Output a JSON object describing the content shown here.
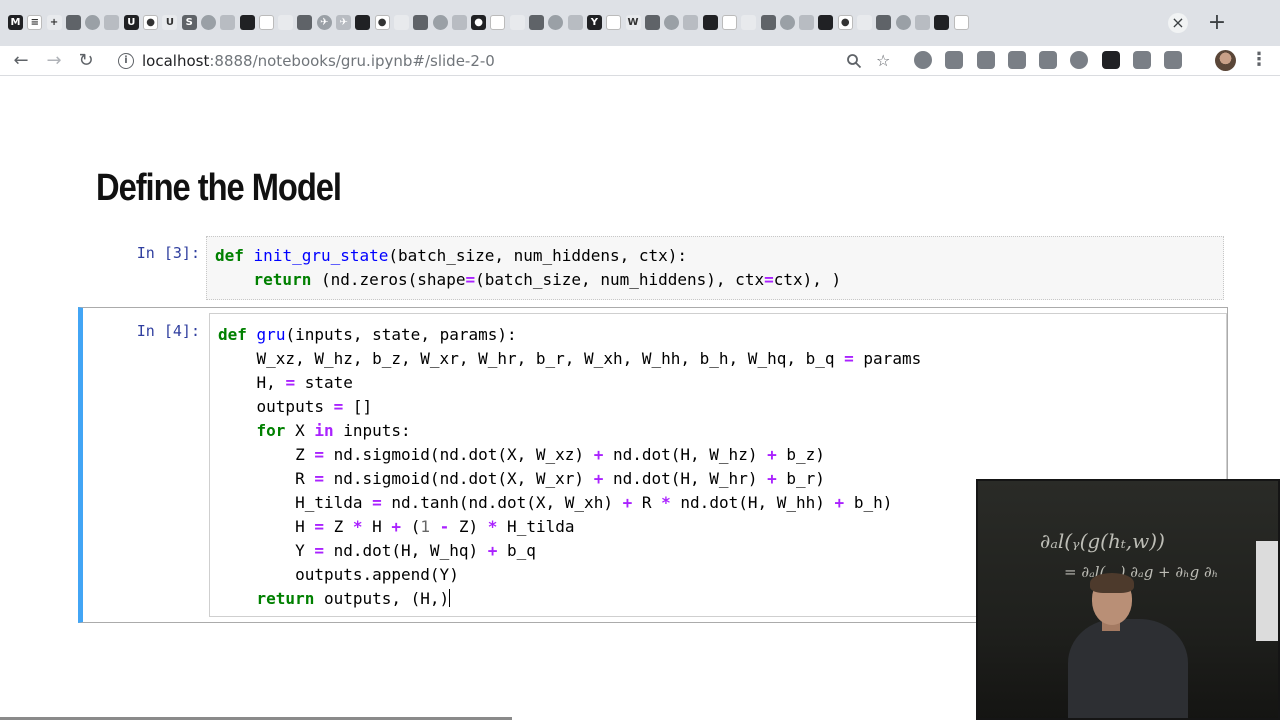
{
  "browser": {
    "bookmark_favicons": [
      "M",
      "≡",
      "+",
      "",
      "",
      "",
      "U",
      "●",
      "U",
      "S",
      "",
      "",
      "",
      "",
      "",
      "",
      "✈",
      "✈",
      "",
      "●",
      "",
      "",
      "",
      "",
      "●",
      "",
      "",
      "",
      "",
      "",
      "Y",
      "",
      "W",
      "",
      "",
      "",
      "",
      "",
      "",
      "",
      "",
      "",
      "",
      "●",
      "",
      "",
      "",
      "",
      "",
      ""
    ],
    "tab_close": "×",
    "new_tab": "+",
    "url_host": "localhost",
    "url_rest": ":8888/notebooks/gru.ipynb#/slide-2-0",
    "nav": {
      "back": "←",
      "forward": "→",
      "reload": "↻"
    },
    "omnibox_icons": {
      "search": "search-icon",
      "star": "☆"
    },
    "menu": "⋮"
  },
  "notebook": {
    "title": "Define the Model",
    "cells": [
      {
        "prompt": "In [3]:",
        "lines": [
          "def init_gru_state(batch_size, num_hiddens, ctx):",
          "    return (nd.zeros(shape=(batch_size, num_hiddens), ctx=ctx), )"
        ]
      },
      {
        "prompt": "In [4]:",
        "lines": [
          "def gru(inputs, state, params):",
          "    W_xz, W_hz, b_z, W_xr, W_hr, b_r, W_xh, W_hh, b_h, W_hq, b_q = params",
          "    H, = state",
          "    outputs = []",
          "    for X in inputs:",
          "        Z = nd.sigmoid(nd.dot(X, W_xz) + nd.dot(H, W_hz) + b_z)",
          "        R = nd.sigmoid(nd.dot(X, W_xr) + nd.dot(H, W_hr) + b_r)",
          "        H_tilda = nd.tanh(nd.dot(X, W_xh) + R * nd.dot(H, W_hh) + b_h)",
          "        H = Z * H + (1 - Z) * H_tilda",
          "        Y = nd.dot(H, W_hq) + b_q",
          "        outputs.append(Y)",
          "    return outputs, (H,)"
        ]
      }
    ]
  },
  "video": {
    "chalk_line1": "∂ₐl(ᵧ(g(hₜ,w))",
    "chalk_line2": "= ∂ₐl(...) ∂ₐg + ∂ₕg ∂ₕ"
  },
  "colors": {
    "keyword": "#008000",
    "function_name": "#0000ff",
    "operator": "#aa22ff",
    "prompt": "#303f9f",
    "selected_cell_bar": "#42a5f5"
  }
}
